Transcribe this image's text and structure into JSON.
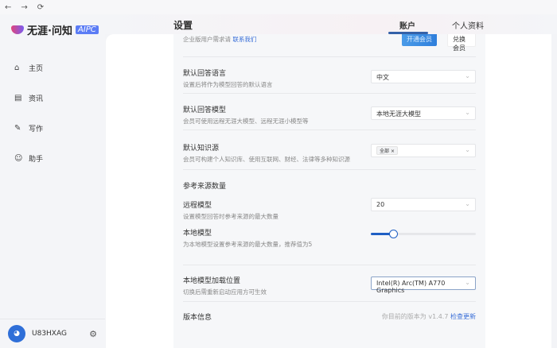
{
  "nav_controls": {
    "back": "←",
    "forward": "→",
    "refresh": "⟳"
  },
  "logo": {
    "name": "无涯·问知",
    "badge": "AIPC"
  },
  "sidebar": {
    "items": [
      {
        "label": "主页",
        "icon": "home-icon"
      },
      {
        "label": "资讯",
        "icon": "news-icon"
      },
      {
        "label": "写作",
        "icon": "pen-icon"
      },
      {
        "label": "助手",
        "icon": "robot-icon"
      }
    ],
    "user": {
      "name": "U83HXAG"
    }
  },
  "header": {
    "title": "设置",
    "tabs": [
      {
        "label": "账户",
        "active": true
      },
      {
        "label": "个人资料",
        "active": false
      }
    ]
  },
  "settings": {
    "membership": {
      "desc": "企业版用户需求请",
      "link": "联系我们",
      "open_btn": "开通会员",
      "redeem_btn": "兑换会员"
    },
    "language": {
      "title": "默认回答语言",
      "desc": "设置后将作为模型回答的默认语言",
      "value": "中文"
    },
    "model": {
      "title": "默认回答模型",
      "desc": "会员可使用远程无涯大模型、远程无涯小模型等",
      "value": "本地无涯大模型"
    },
    "knowledge": {
      "title": "默认知识源",
      "desc": "会员可构建个人知识库、使用互联网、财经、法律等多种知识源",
      "tag": "全部"
    },
    "ref_count": {
      "title": "参考来源数量",
      "remote": {
        "title": "远程模型",
        "desc": "设置模型回答时参考来源的最大数量",
        "value": "20"
      },
      "local": {
        "title": "本地模型",
        "desc": "为本地模型设置参考来源的最大数量，推荐值为5",
        "slider_fraction": 0.21
      }
    },
    "load": {
      "title": "本地模型加载位置",
      "desc": "切换后需重新启动应用方可生效",
      "value": "Intel(R) Arc(TM) A770 Graphics"
    },
    "version": {
      "title": "版本信息",
      "text": "你目前的版本为 v1.4.7",
      "link": "检查更新"
    }
  },
  "colors": {
    "accent": "#1f5fc4",
    "link": "#3a6fd8"
  }
}
